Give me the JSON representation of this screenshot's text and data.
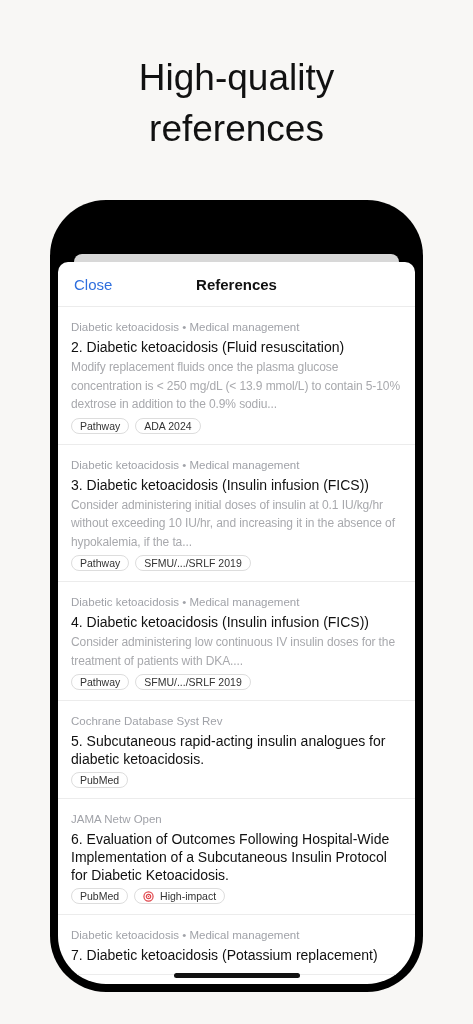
{
  "headline": "High-quality references",
  "sheet": {
    "close": "Close",
    "title": "References"
  },
  "references": [
    {
      "meta": "Diabetic ketoacidosis • Medical management",
      "title": "2. Diabetic ketoacidosis (Fluid resuscitation)",
      "snippet": "Modify replacement fluids once the plasma glucose concentration is < 250 mg/dL (< 13.9 mmol/L) to contain 5-10% dextrose in addition to the 0.9% sodiu...",
      "tags": [
        {
          "kind": "source",
          "label": "Pathway"
        },
        {
          "kind": "source",
          "label": "ADA 2024"
        }
      ]
    },
    {
      "meta": "Diabetic ketoacidosis • Medical management",
      "title": "3. Diabetic ketoacidosis (Insulin infusion (FICS))",
      "snippet": "Consider administering initial doses of insulin at 0.1 IU/kg/hr without exceeding 10 IU/hr, and increasing it in the absence of hypokalemia, if the ta...",
      "tags": [
        {
          "kind": "source",
          "label": "Pathway"
        },
        {
          "kind": "source",
          "label": "SFMU/.../SRLF 2019"
        }
      ]
    },
    {
      "meta": "Diabetic ketoacidosis • Medical management",
      "title": "4. Diabetic ketoacidosis (Insulin infusion (FICS))",
      "snippet": "Consider administering low continuous IV insulin doses for the treatment of patients with DKA....",
      "tags": [
        {
          "kind": "source",
          "label": "Pathway"
        },
        {
          "kind": "source",
          "label": "SFMU/.../SRLF 2019"
        }
      ]
    },
    {
      "meta": "Cochrane Database Syst Rev",
      "title": "5. Subcutaneous rapid-acting insulin analogues for diabetic ketoacidosis.",
      "tags": [
        {
          "kind": "source",
          "label": "PubMed"
        }
      ]
    },
    {
      "meta": "JAMA Netw Open",
      "title": "6. Evaluation of Outcomes Following Hospital-Wide Implementation of a Subcutaneous Insulin Protocol for Diabetic Ketoacidosis.",
      "tags": [
        {
          "kind": "source",
          "label": "PubMed"
        },
        {
          "kind": "impact",
          "label": "High-impact"
        }
      ]
    },
    {
      "meta": "Diabetic ketoacidosis • Medical management",
      "title": "7. Diabetic ketoacidosis (Potassium replacement)"
    }
  ]
}
